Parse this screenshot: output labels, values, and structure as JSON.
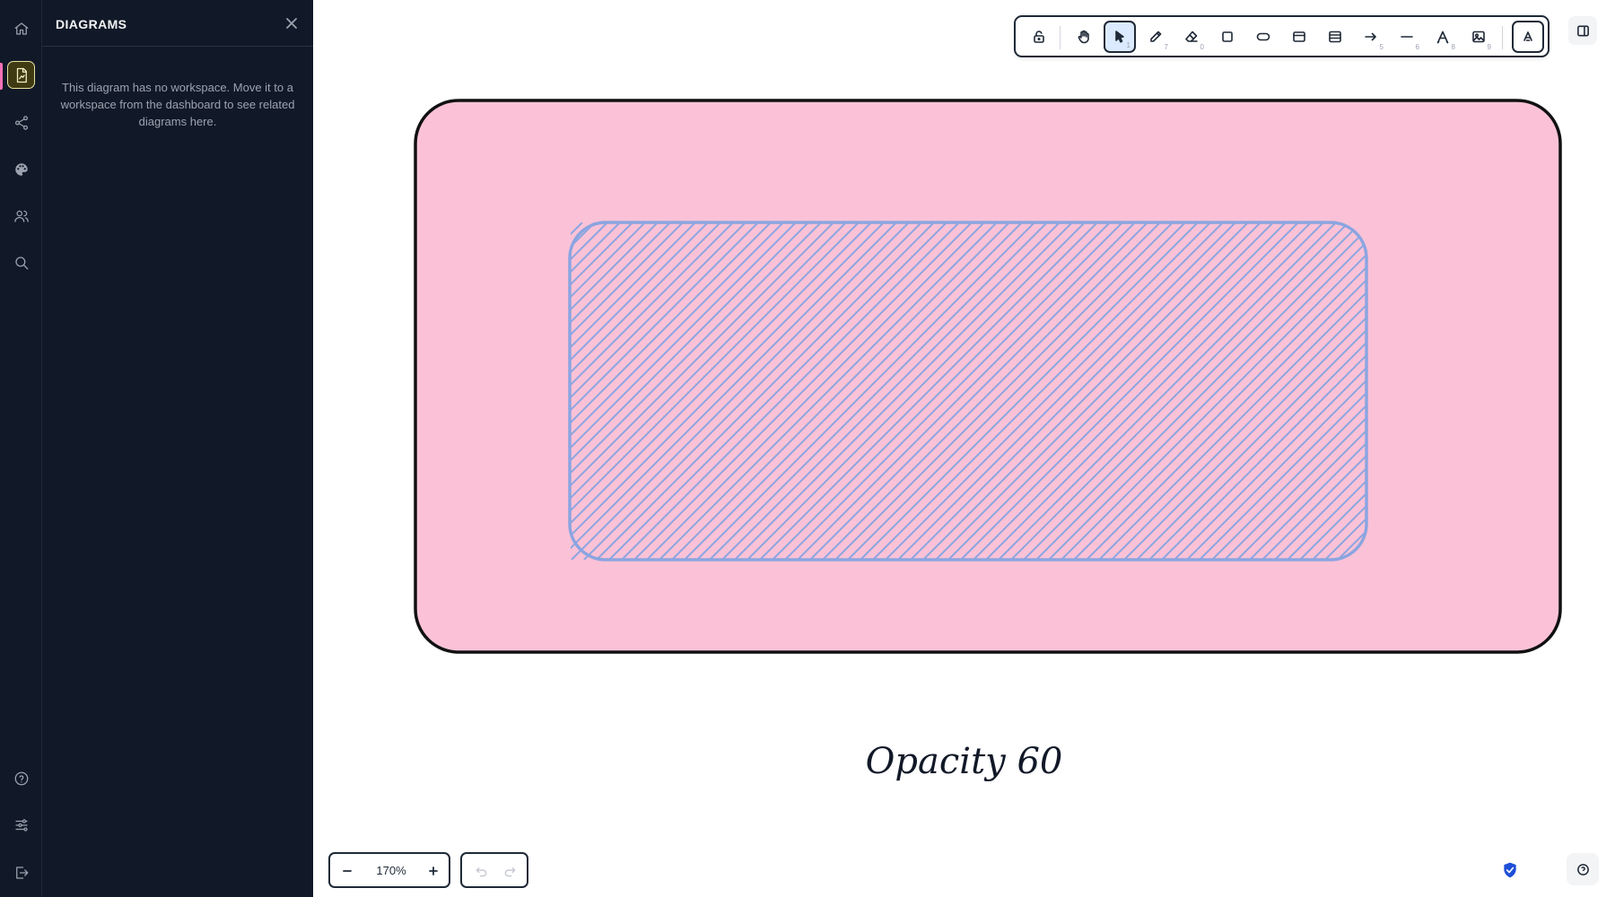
{
  "sidebar": {
    "rail_items": [
      {
        "name": "home",
        "icon": "home-icon"
      },
      {
        "name": "diagrams",
        "icon": "diagram-file-icon",
        "active": true
      },
      {
        "name": "share",
        "icon": "share-icon"
      },
      {
        "name": "theme",
        "icon": "palette-icon"
      },
      {
        "name": "collaborators",
        "icon": "users-icon"
      },
      {
        "name": "search",
        "icon": "search-icon"
      }
    ],
    "rail_bottom": [
      {
        "name": "help",
        "icon": "help-circle-icon"
      },
      {
        "name": "settings",
        "icon": "sliders-icon"
      },
      {
        "name": "logout",
        "icon": "logout-icon"
      }
    ]
  },
  "panel": {
    "title": "DIAGRAMS",
    "message": "This diagram has no workspace. Move it to a workspace from the dashboard to see related diagrams here."
  },
  "toolbar": {
    "tools": [
      {
        "name": "lock",
        "icon": "lock-open-icon",
        "key": ""
      },
      {
        "name": "hand",
        "icon": "hand-icon",
        "key": ""
      },
      {
        "name": "select",
        "icon": "cursor-icon",
        "key": "1",
        "active": true
      },
      {
        "name": "pencil",
        "icon": "pencil-icon",
        "key": "7"
      },
      {
        "name": "eraser",
        "icon": "eraser-icon",
        "key": "0"
      },
      {
        "name": "rectangle",
        "icon": "square-icon",
        "key": ""
      },
      {
        "name": "ellipse",
        "icon": "pill-icon",
        "key": ""
      },
      {
        "name": "frame",
        "icon": "frame-icon",
        "key": ""
      },
      {
        "name": "table",
        "icon": "table-icon",
        "key": ""
      },
      {
        "name": "arrow",
        "icon": "arrow-right-icon",
        "key": "5"
      },
      {
        "name": "line",
        "icon": "line-icon",
        "key": "6"
      },
      {
        "name": "text",
        "icon": "text-icon",
        "key": "8"
      },
      {
        "name": "image",
        "icon": "image-icon",
        "key": "9"
      },
      {
        "name": "ai",
        "icon": "sparkle-icon",
        "key": ""
      }
    ]
  },
  "canvas": {
    "outer_fill": "#fbc2d7",
    "outer_stroke": "#111111",
    "inner_stroke": "#8ba5e0",
    "caption": "Opacity 60"
  },
  "zoom": {
    "level": "170%"
  },
  "colors": {
    "rail_bg": "#111827",
    "accent": "#1d4ed8"
  }
}
